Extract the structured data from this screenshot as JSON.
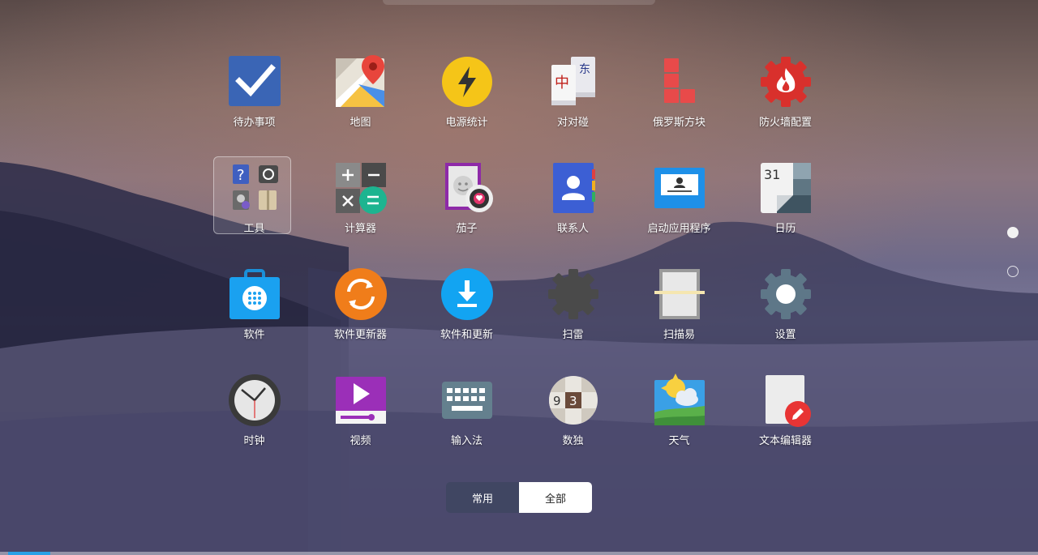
{
  "launcher": {
    "apps": [
      {
        "label": "待办事项",
        "icon": "todo-check-icon"
      },
      {
        "label": "地图",
        "icon": "map-pin-icon"
      },
      {
        "label": "电源统计",
        "icon": "power-bolt-icon"
      },
      {
        "label": "对对碰",
        "icon": "mahjong-tiles-icon"
      },
      {
        "label": "俄罗斯方块",
        "icon": "tetris-blocks-icon"
      },
      {
        "label": "防火墙配置",
        "icon": "firewall-gear-icon"
      },
      {
        "label": "工具",
        "icon": "tools-folder-icon"
      },
      {
        "label": "计算器",
        "icon": "calculator-icon"
      },
      {
        "label": "茄子",
        "icon": "cheese-camera-icon"
      },
      {
        "label": "联系人",
        "icon": "contacts-icon"
      },
      {
        "label": "启动应用程序",
        "icon": "startup-apps-icon"
      },
      {
        "label": "日历",
        "icon": "calendar-icon"
      },
      {
        "label": "软件",
        "icon": "software-bag-icon"
      },
      {
        "label": "软件更新器",
        "icon": "software-updater-icon"
      },
      {
        "label": "软件和更新",
        "icon": "software-update-download-icon"
      },
      {
        "label": "扫雷",
        "icon": "mines-gear-icon"
      },
      {
        "label": "扫描易",
        "icon": "scanner-icon"
      },
      {
        "label": "设置",
        "icon": "settings-gear-icon"
      },
      {
        "label": "时钟",
        "icon": "clock-icon"
      },
      {
        "label": "视频",
        "icon": "video-play-icon"
      },
      {
        "label": "输入法",
        "icon": "keyboard-icon"
      },
      {
        "label": "数独",
        "icon": "sudoku-icon"
      },
      {
        "label": "天气",
        "icon": "weather-icon"
      },
      {
        "label": "文本编辑器",
        "icon": "text-editor-icon"
      }
    ],
    "calendar_day": "31",
    "sudoku_digits": [
      "9",
      "3"
    ]
  },
  "view_switch": {
    "frequent": "常用",
    "all": "全部",
    "selected": "all"
  },
  "pager": {
    "pages": 2,
    "current": 1
  },
  "colors": {
    "accent": "#2aa0e6",
    "todo_blue": "#3a65b5",
    "power_yellow": "#f5c518",
    "tetris_red": "#e84a4a",
    "firewall_red": "#d9302c",
    "updater_orange": "#f07d1a",
    "software_blue": "#1aa1f0",
    "video_purple": "#9b2fb8"
  }
}
